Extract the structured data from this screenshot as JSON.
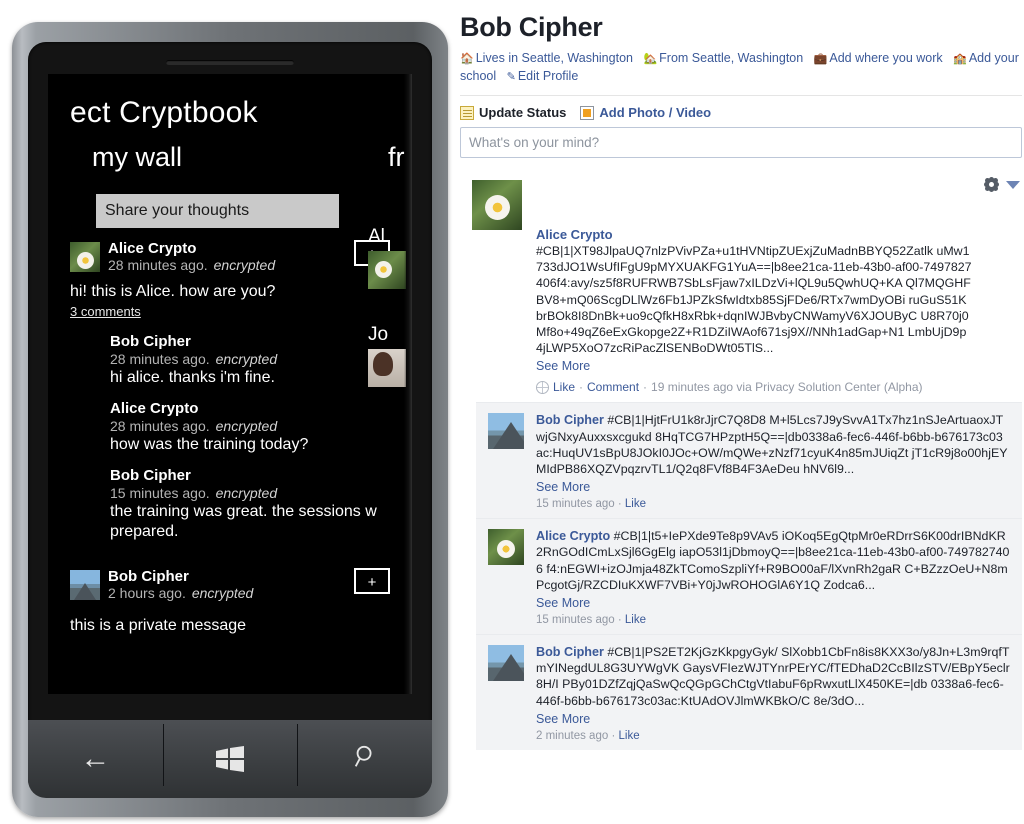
{
  "phone": {
    "app_title": "ect Cryptbook",
    "pivot_selected": "my wall",
    "pivot_next": "fr",
    "share_placeholder": "Share your thoughts",
    "comments_link": "3 comments",
    "plus_label": "+",
    "side_peek": {
      "name_a": "Al",
      "name_b": "Jo"
    },
    "posts": [
      {
        "author": "Alice Crypto",
        "time": "28 minutes ago.",
        "encrypted_label": "encrypted",
        "body": "hi! this is Alice. how are you?",
        "avatar": "daisy-avatar",
        "comments": [
          {
            "author": "Bob Cipher",
            "time": "28 minutes ago.",
            "encrypted_label": "encrypted",
            "body": "hi alice. thanks i'm fine."
          },
          {
            "author": "Alice Crypto",
            "time": "28 minutes ago.",
            "encrypted_label": "encrypted",
            "body": "how was the training today?"
          },
          {
            "author": "Bob Cipher",
            "time": "15 minutes ago.",
            "encrypted_label": "encrypted",
            "body": "the training was great. the sessions w prepared."
          }
        ]
      },
      {
        "author": "Bob Cipher",
        "time": "2 hours ago.",
        "encrypted_label": "encrypted",
        "body": "this is a private message",
        "avatar": "mountain-avatar",
        "comments": []
      }
    ],
    "keys": {
      "back": "back-button",
      "start": "windows-start-button",
      "search": "search-button"
    }
  },
  "facebook": {
    "profile_name": "Bob Cipher",
    "profile_links": [
      {
        "icon": "home-icon",
        "label": "Lives in Seattle, Washington"
      },
      {
        "icon": "house-icon",
        "label": "From Seattle, Washington"
      },
      {
        "icon": "briefcase-icon",
        "label": "Add where you work"
      },
      {
        "icon": "school-icon",
        "label": "Add your school"
      },
      {
        "icon": "pencil-icon",
        "label": "Edit Profile"
      }
    ],
    "composer": {
      "tab_status": "Update Status",
      "tab_photo": "Add Photo / Video",
      "placeholder": "What's on your mind?"
    },
    "post": {
      "author": "Alice Crypto",
      "avatar": "daisy-avatar",
      "cipher": "#CB|1|XT98JlpaUQ7nlzPVivPZa+u1tHVNtipZUExjZuMadnBBYQ52Zatlk uMw1733dJO1WsUfIFgU9pMYXUAKFG1YuA==|b8ee21ca-11eb-43b0-af00-7497827406f4:avy/sz5f8RUFRWB7SbLsFjaw7xILDzVi+lQL9u5QwhUQ+KA Ql7MQGHFBV8+mQ06ScgDLlWz6Fb1JPZkSfwIdtxb85SjFDe6/RTx7wmDyOBi ruGuS51KbrBOk8I8DnBk+uo9cQfkH8xRbk+dqnIWJBvbyCNWamyV6XJOUByC U8R70j0Mf8o+49qZ6eExGkopge2Z+R1DZiIWAof671sj9X//NNh1adGap+N1 LmbUjD9p4jLWP5XoO7zcRiPacZlSENBoDWt05TlS...",
      "see_more": "See More",
      "like": "Like",
      "comment": "Comment",
      "time_via": "19 minutes ago via Privacy Solution Center (Alpha)",
      "settings_icon": "gear-icon",
      "dropdown_icon": "caret-down-icon"
    },
    "comments": [
      {
        "author": "Bob Cipher",
        "avatar": "mountain-avatar",
        "cipher": "#CB|1|HjtFrU1k8rJjrC7Q8D8 M+l5Lcs7J9ySvvA1Tx7hz1nSJeArtuaoxJTwjGNxyAuxxsxcgukd 8HqTCG7HPzptH5Q==|db0338a6-fec6-446f-b6bb-b676173c03 ac:HuqUV1sBpU8JOkI0JOc+OW/mQWe+zNzf71cyuK4n85mJUiqZt jT1cR9j8o00hjEYMIdPB86XQZVpqzrvTL1/Q2q8FVf8B4F3AeDeu hNV6l9...",
        "see_more": "See More",
        "time": "15 minutes ago",
        "like": "Like"
      },
      {
        "author": "Alice Crypto",
        "avatar": "daisy-avatar",
        "cipher": "#CB|1|t5+IePXde9Te8p9VAv5 iOKoq5EgQtpMr0eRDrrS6K00drIBNdKR2RnGOdICmLxSjl6GgElg iapO53l1jDbmoyQ==|b8ee21ca-11eb-43b0-af00-7497827406 f4:nEGWI+izOJmja48ZkTComoSzpliYf+R9BO00aF/lXvnRh2gaR C+BZzzOeU+N8mPcgotGj/RZCDIuKXWF7VBi+Y0jJwROHOGlA6Y1Q Zodca6...",
        "see_more": "See More",
        "time": "15 minutes ago",
        "like": "Like"
      },
      {
        "author": "Bob Cipher",
        "avatar": "mountain-avatar",
        "cipher": "#CB|1|PS2ET2KjGzKkpgyGyk/ SlXobb1CbFn8is8KXX3o/y8Jn+L3m9rqfTmYINegdUL8G3UYWgVK GaysVFIezWJTYnrPErYC/fTEDhaD2CcBIlzSTV/EBpY5eclr8H/I PBy01DZfZqjQaSwQcQGpGChCtgVtIabuF6pRwxutLlX450KE=|db 0338a6-fec6-446f-b6bb-b676173c03ac:KtUAdOVJlmWKBkO/C 8e/3dO...",
        "see_more": "See More",
        "time": "2 minutes ago",
        "like": "Like"
      }
    ]
  }
}
